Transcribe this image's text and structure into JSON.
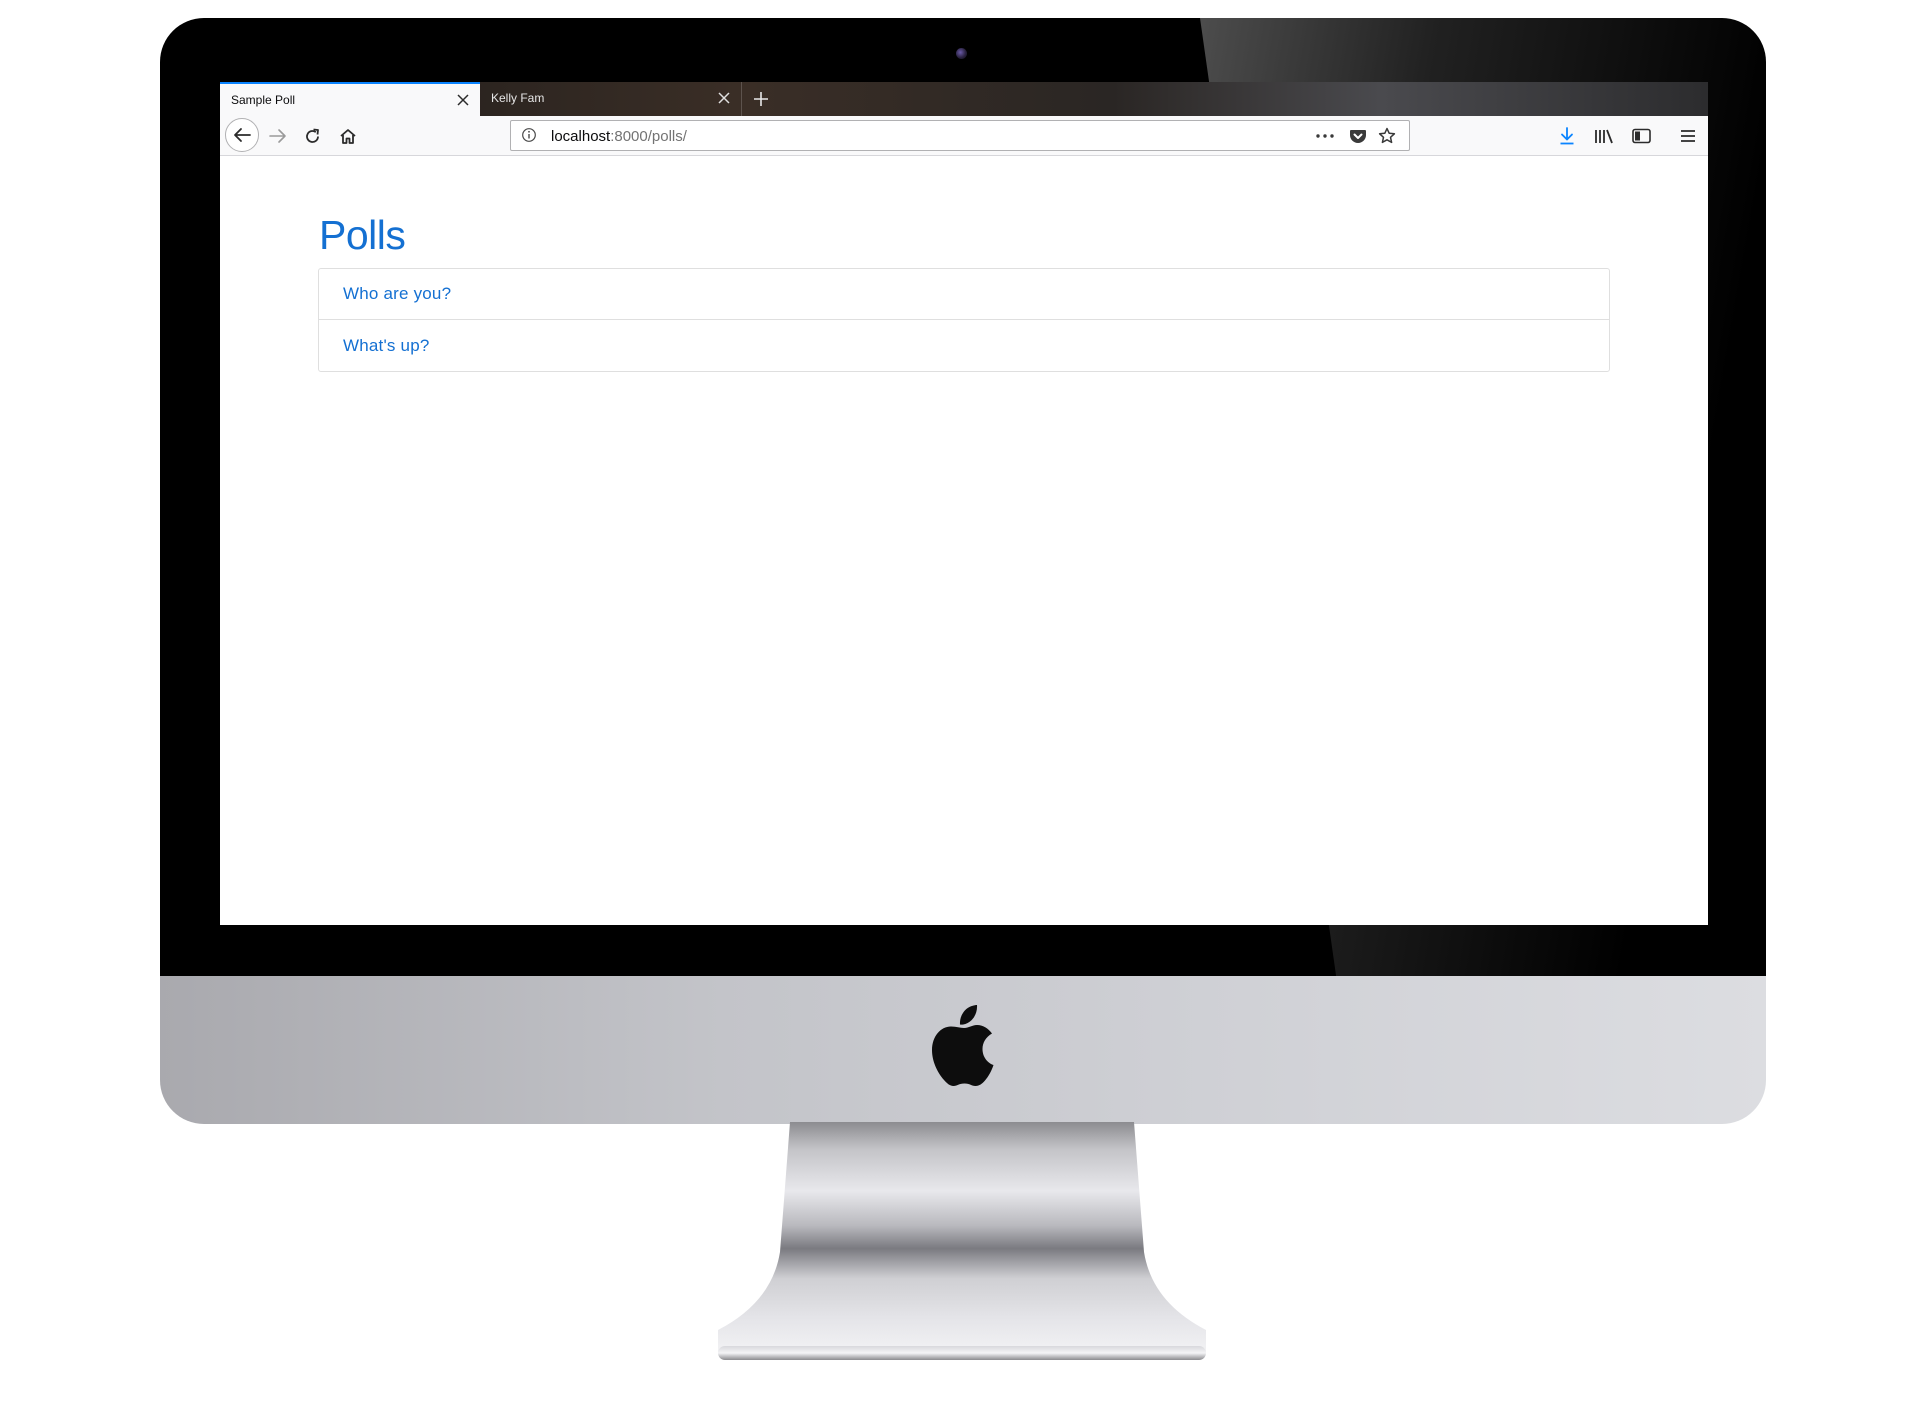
{
  "browser": {
    "tabs": [
      {
        "title": "Sample Poll",
        "active": true
      },
      {
        "title": "Kelly Fam",
        "active": false
      }
    ],
    "url": {
      "host": "localhost",
      "rest": ":8000/polls/"
    },
    "accent_color": "#0a84ff"
  },
  "page": {
    "title": "Polls",
    "link_color": "#1470d2",
    "polls": [
      {
        "question": "Who are you?"
      },
      {
        "question": "What's up?"
      }
    ]
  },
  "icons": {
    "tab_close": "close-icon",
    "new_tab": "plus-icon",
    "back": "arrow-left-icon",
    "forward": "arrow-right-icon",
    "reload": "reload-icon",
    "home": "home-icon",
    "site_info": "info-icon",
    "page_actions": "more-icon",
    "pocket": "pocket-icon",
    "bookmark": "star-icon",
    "downloads": "download-icon",
    "library": "library-icon",
    "sidebar": "sidebar-icon",
    "menu": "hamburger-menu-icon"
  }
}
